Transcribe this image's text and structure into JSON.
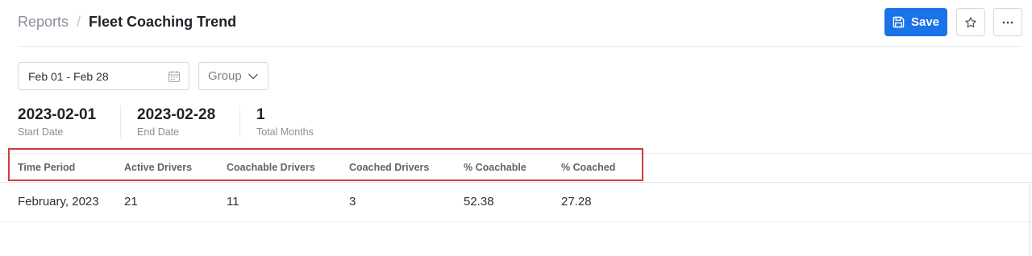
{
  "breadcrumb": {
    "root": "Reports",
    "separator": "/",
    "current": "Fleet Coaching Trend"
  },
  "actions": {
    "save_label": "Save",
    "star_icon": "star-icon",
    "more_icon": "more-icon"
  },
  "filters": {
    "date_range": "Feb 01 - Feb 28",
    "group_placeholder": "Group"
  },
  "stats": [
    {
      "value": "2023-02-01",
      "label": "Start Date"
    },
    {
      "value": "2023-02-28",
      "label": "End Date"
    },
    {
      "value": "1",
      "label": "Total Months"
    }
  ],
  "table": {
    "columns": [
      "Time Period",
      "Active Drivers",
      "Coachable Drivers",
      "Coached Drivers",
      "% Coachable",
      "% Coached"
    ],
    "rows": [
      [
        "February, 2023",
        "21",
        "11",
        "3",
        "52.38",
        "27.28"
      ]
    ]
  },
  "colors": {
    "accent": "#1a73e8",
    "highlight": "#d13b3b"
  }
}
